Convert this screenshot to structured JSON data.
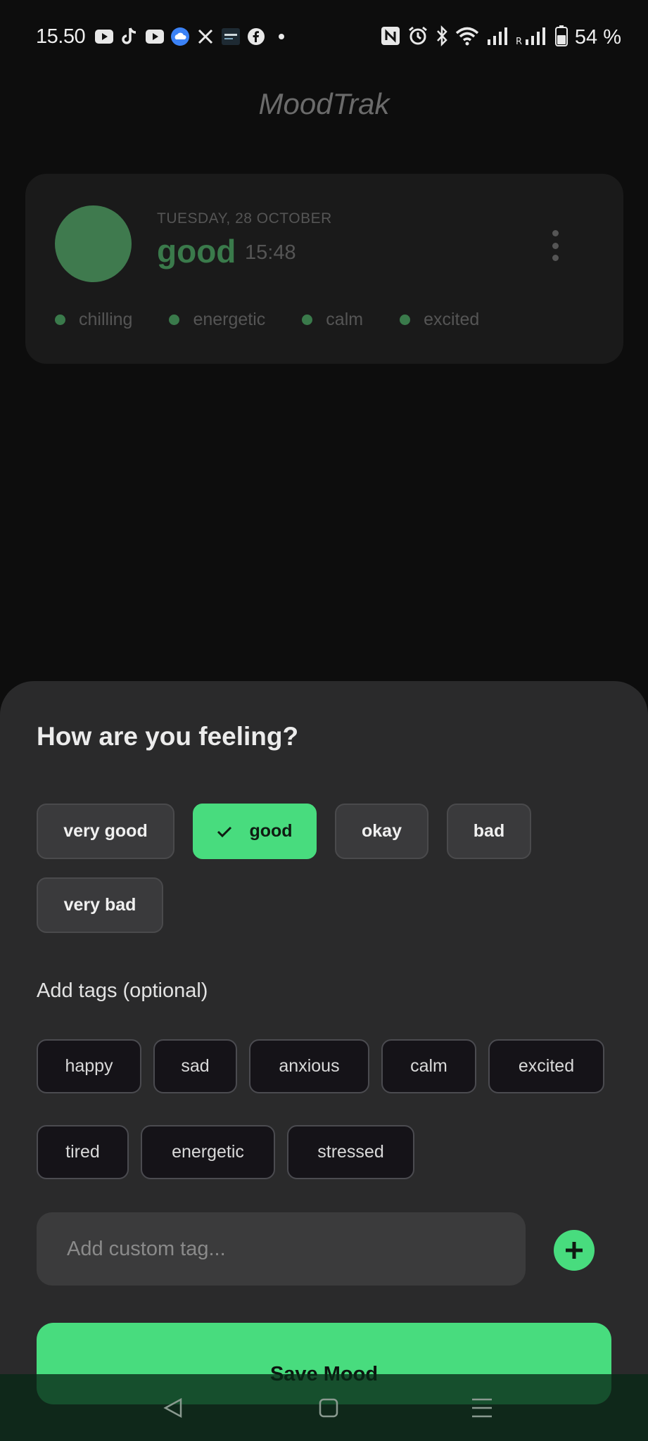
{
  "status_bar": {
    "time": "15.50",
    "battery": "54 %",
    "left_icons": [
      "youtube-icon",
      "tiktok-icon",
      "youtube-icon",
      "weather-icon",
      "x-icon",
      "news-icon",
      "facebook-icon",
      "dot-icon"
    ],
    "right_icons": [
      "nfc-icon",
      "alarm-icon",
      "bluetooth-icon",
      "wifi-icon",
      "signal-icon",
      "signal-roaming-icon",
      "battery-icon"
    ]
  },
  "app": {
    "title": "MoodTrak"
  },
  "entry": {
    "date": "TUESDAY, 28 OCTOBER",
    "mood": "good",
    "time": "15:48",
    "tags": [
      "chilling",
      "energetic",
      "calm",
      "excited"
    ],
    "mood_color": "#3f7a4e"
  },
  "sheet": {
    "title": "How are you feeling?",
    "moods": [
      {
        "label": "very good",
        "selected": false
      },
      {
        "label": "good",
        "selected": true
      },
      {
        "label": "okay",
        "selected": false
      },
      {
        "label": "bad",
        "selected": false
      },
      {
        "label": "very bad",
        "selected": false
      }
    ],
    "tags_title": "Add tags (optional)",
    "tags": [
      "happy",
      "sad",
      "anxious",
      "calm",
      "excited",
      "tired",
      "energetic",
      "stressed"
    ],
    "custom_tag_placeholder": "Add custom tag...",
    "custom_tag_value": "",
    "save_label": "Save Mood",
    "accent_color": "#48dc7e"
  },
  "nav": {
    "buttons": [
      "back-icon",
      "home-icon",
      "recents-icon"
    ]
  }
}
